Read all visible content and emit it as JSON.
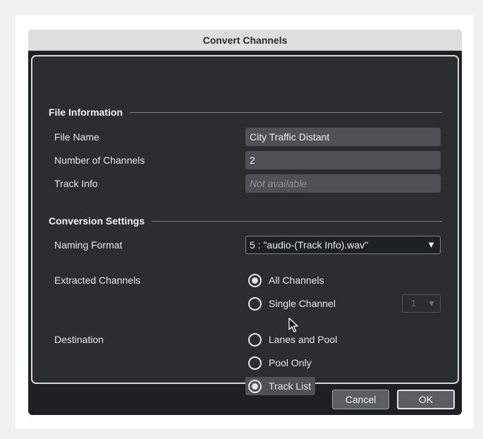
{
  "dialog": {
    "title": "Convert Channels"
  },
  "file_information": {
    "heading": "File Information",
    "file_name": {
      "label": "File Name",
      "value": "City Traffic Distant"
    },
    "num_channels": {
      "label": "Number of Channels",
      "value": "2"
    },
    "track_info": {
      "label": "Track Info",
      "placeholder": "Not available"
    }
  },
  "conversion_settings": {
    "heading": "Conversion Settings",
    "naming_format": {
      "label": "Naming Format",
      "value": "5 : \"audio-(Track Info).wav\""
    },
    "extracted_channels": {
      "label": "Extracted Channels",
      "options": [
        "All Channels",
        "Single Channel"
      ],
      "selected": "All Channels",
      "single_channel_value": "1"
    },
    "destination": {
      "label": "Destination",
      "options": [
        "Lanes and Pool",
        "Pool Only",
        "Track List"
      ],
      "selected": "Track List"
    }
  },
  "buttons": {
    "cancel": "Cancel",
    "ok": "OK"
  },
  "icons": {
    "dropdown": "▼"
  }
}
